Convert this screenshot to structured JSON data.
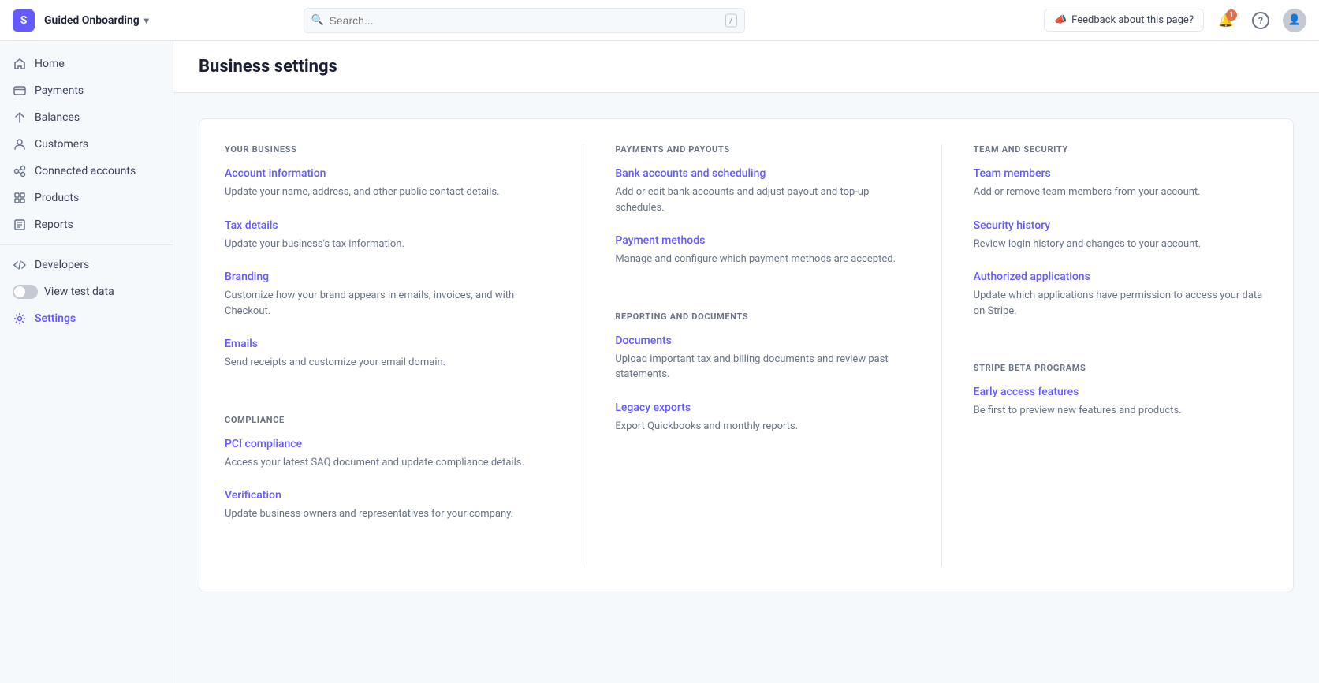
{
  "topbar": {
    "logo_text": "S",
    "brand_label": "Guided Onboarding",
    "brand_chevron": "▾",
    "search_placeholder": "Search...",
    "search_slash": "/",
    "feedback_label": "Feedback about this page?",
    "feedback_icon": "📣",
    "notif_count": "1",
    "help_icon": "?",
    "avatar_icon": "👤"
  },
  "sidebar": {
    "items": [
      {
        "id": "home",
        "label": "Home",
        "icon": "🏠"
      },
      {
        "id": "payments",
        "label": "Payments",
        "icon": "💳"
      },
      {
        "id": "balances",
        "label": "Balances",
        "icon": "⚖️"
      },
      {
        "id": "customers",
        "label": "Customers",
        "icon": "👥"
      },
      {
        "id": "connected-accounts",
        "label": "Connected accounts",
        "icon": "🔗"
      },
      {
        "id": "products",
        "label": "Products",
        "icon": "📦"
      },
      {
        "id": "reports",
        "label": "Reports",
        "icon": "📊"
      },
      {
        "id": "developers",
        "label": "Developers",
        "icon": "⌨️"
      }
    ],
    "test_data_label": "View test data",
    "settings_label": "Settings"
  },
  "page": {
    "title": "Business settings",
    "columns": [
      {
        "sections": [
          {
            "id": "your-business",
            "title": "YOUR BUSINESS",
            "links": [
              {
                "label": "Account information",
                "desc": "Update your name, address, and other public contact details."
              },
              {
                "label": "Tax details",
                "desc": "Update your business's tax information."
              },
              {
                "label": "Branding",
                "desc": "Customize how your brand appears in emails, invoices, and with Checkout."
              },
              {
                "label": "Emails",
                "desc": "Send receipts and customize your email domain."
              }
            ]
          },
          {
            "id": "compliance",
            "title": "COMPLIANCE",
            "links": [
              {
                "label": "PCI compliance",
                "desc": "Access your latest SAQ document and update compliance details."
              },
              {
                "label": "Verification",
                "desc": "Update business owners and representatives for your company."
              }
            ]
          }
        ]
      },
      {
        "sections": [
          {
            "id": "payments-and-payouts",
            "title": "PAYMENTS AND PAYOUTS",
            "links": [
              {
                "label": "Bank accounts and scheduling",
                "desc": "Add or edit bank accounts and adjust payout and top-up schedules."
              },
              {
                "label": "Payment methods",
                "desc": "Manage and configure which payment methods are accepted."
              }
            ]
          },
          {
            "id": "reporting-and-documents",
            "title": "REPORTING AND DOCUMENTS",
            "links": [
              {
                "label": "Documents",
                "desc": "Upload important tax and billing documents and review past statements."
              },
              {
                "label": "Legacy exports",
                "desc": "Export Quickbooks and monthly reports."
              }
            ]
          }
        ]
      },
      {
        "sections": [
          {
            "id": "team-and-security",
            "title": "TEAM AND SECURITY",
            "links": [
              {
                "label": "Team members",
                "desc": "Add or remove team members from your account."
              },
              {
                "label": "Security history",
                "desc": "Review login history and changes to your account."
              },
              {
                "label": "Authorized applications",
                "desc": "Update which applications have permission to access your data on Stripe."
              }
            ]
          },
          {
            "id": "stripe-beta-programs",
            "title": "STRIPE BETA PROGRAMS",
            "links": [
              {
                "label": "Early access features",
                "desc": "Be first to preview new features and products."
              }
            ]
          }
        ]
      }
    ]
  }
}
